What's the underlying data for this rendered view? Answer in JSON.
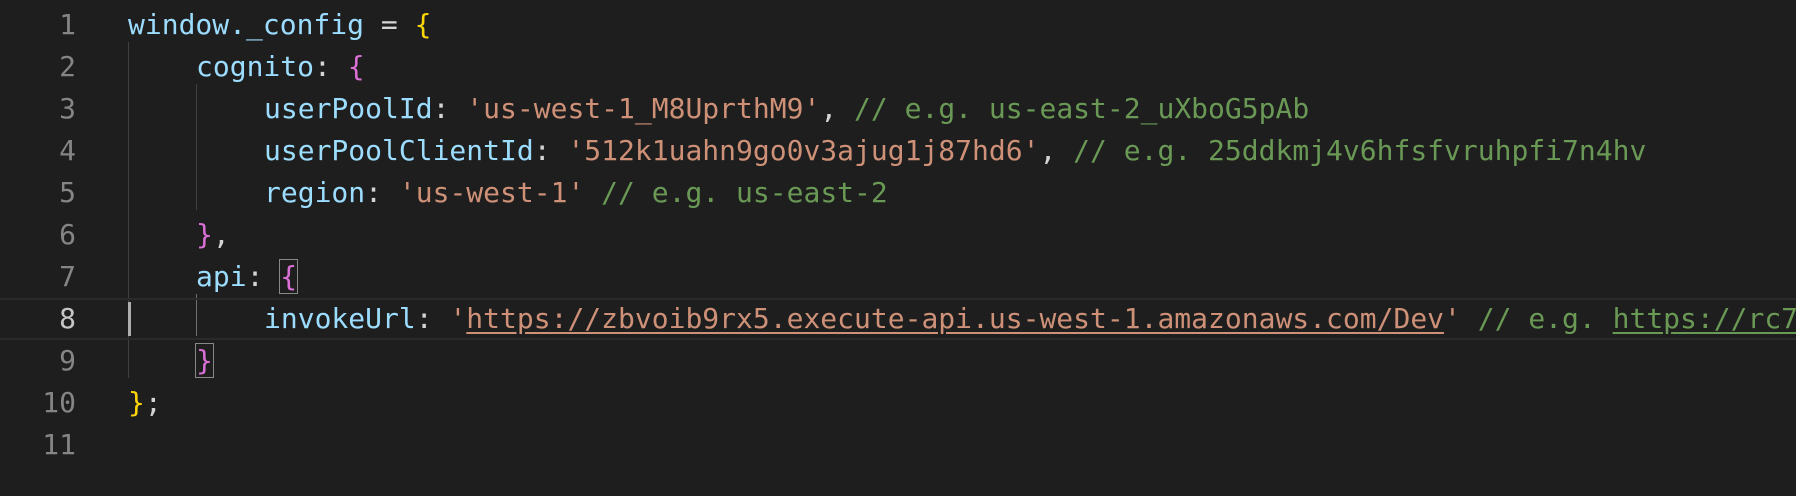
{
  "theme": {
    "background": "#1e1e1e",
    "line_number": "#858585",
    "line_number_active": "#c6c6c6",
    "indent_guide": "#404040",
    "indent_guide_active": "#707070"
  },
  "colors": {
    "variable": "#9cdcfe",
    "punctuation": "#d4d4d4",
    "string": "#ce9178",
    "comment": "#6a9955",
    "bracket_level1": "#ffd700",
    "bracket_level2": "#da70d6",
    "bracket_level3": "#179fff"
  },
  "editor": {
    "active_line": 8,
    "lines": [
      {
        "number": "1",
        "indent": 0,
        "tokens": [
          {
            "text": "window._config",
            "kind": "variable"
          },
          {
            "text": " = ",
            "kind": "punctuation"
          },
          {
            "text": "{",
            "kind": "bracket_level1"
          }
        ]
      },
      {
        "number": "2",
        "indent": 1,
        "tokens": [
          {
            "text": "cognito",
            "kind": "variable"
          },
          {
            "text": ": ",
            "kind": "punctuation"
          },
          {
            "text": "{",
            "kind": "bracket_level2"
          }
        ]
      },
      {
        "number": "3",
        "indent": 2,
        "tokens": [
          {
            "text": "userPoolId",
            "kind": "variable"
          },
          {
            "text": ": ",
            "kind": "punctuation"
          },
          {
            "text": "'us-west-1_M8UprthM9'",
            "kind": "string"
          },
          {
            "text": ", ",
            "kind": "punctuation"
          },
          {
            "text": "// e.g. us-east-2_uXboG5pAb",
            "kind": "comment"
          }
        ]
      },
      {
        "number": "4",
        "indent": 2,
        "tokens": [
          {
            "text": "userPoolClientId",
            "kind": "variable"
          },
          {
            "text": ": ",
            "kind": "punctuation"
          },
          {
            "text": "'512k1uahn9go0v3ajug1j87hd6'",
            "kind": "string"
          },
          {
            "text": ", ",
            "kind": "punctuation"
          },
          {
            "text": "// e.g. 25ddkmj4v6hfsfvruhpfi7n4hv",
            "kind": "comment"
          }
        ]
      },
      {
        "number": "5",
        "indent": 2,
        "tokens": [
          {
            "text": "region",
            "kind": "variable"
          },
          {
            "text": ": ",
            "kind": "punctuation"
          },
          {
            "text": "'us-west-1'",
            "kind": "string"
          },
          {
            "text": " ",
            "kind": "punctuation"
          },
          {
            "text": "// e.g. us-east-2",
            "kind": "comment"
          }
        ]
      },
      {
        "number": "6",
        "indent": 1,
        "tokens": [
          {
            "text": "}",
            "kind": "bracket_level2"
          },
          {
            "text": ",",
            "kind": "punctuation"
          }
        ]
      },
      {
        "number": "7",
        "indent": 1,
        "tokens": [
          {
            "text": "api",
            "kind": "variable"
          },
          {
            "text": ": ",
            "kind": "punctuation"
          },
          {
            "text": "{",
            "kind": "bracket_level2",
            "match": true
          }
        ]
      },
      {
        "number": "8",
        "indent": 2,
        "tokens": [
          {
            "text": "invokeUrl",
            "kind": "variable"
          },
          {
            "text": ": ",
            "kind": "punctuation"
          },
          {
            "text": "'",
            "kind": "string"
          },
          {
            "text": "https://zbvoib9rx5.execute-api.us-west-1.amazonaws.com/Dev",
            "kind": "string",
            "link": true
          },
          {
            "text": "'",
            "kind": "string"
          },
          {
            "text": " ",
            "kind": "punctuation"
          },
          {
            "text": "// e.g. ",
            "kind": "comment"
          },
          {
            "text": "https://rc7",
            "kind": "comment",
            "link": true
          }
        ]
      },
      {
        "number": "9",
        "indent": 1,
        "tokens": [
          {
            "text": "}",
            "kind": "bracket_level2",
            "match": true
          }
        ]
      },
      {
        "number": "10",
        "indent": 0,
        "tokens": [
          {
            "text": "}",
            "kind": "bracket_level1"
          },
          {
            "text": ";",
            "kind": "punctuation"
          }
        ]
      },
      {
        "number": "11",
        "indent": 0,
        "tokens": []
      }
    ]
  }
}
